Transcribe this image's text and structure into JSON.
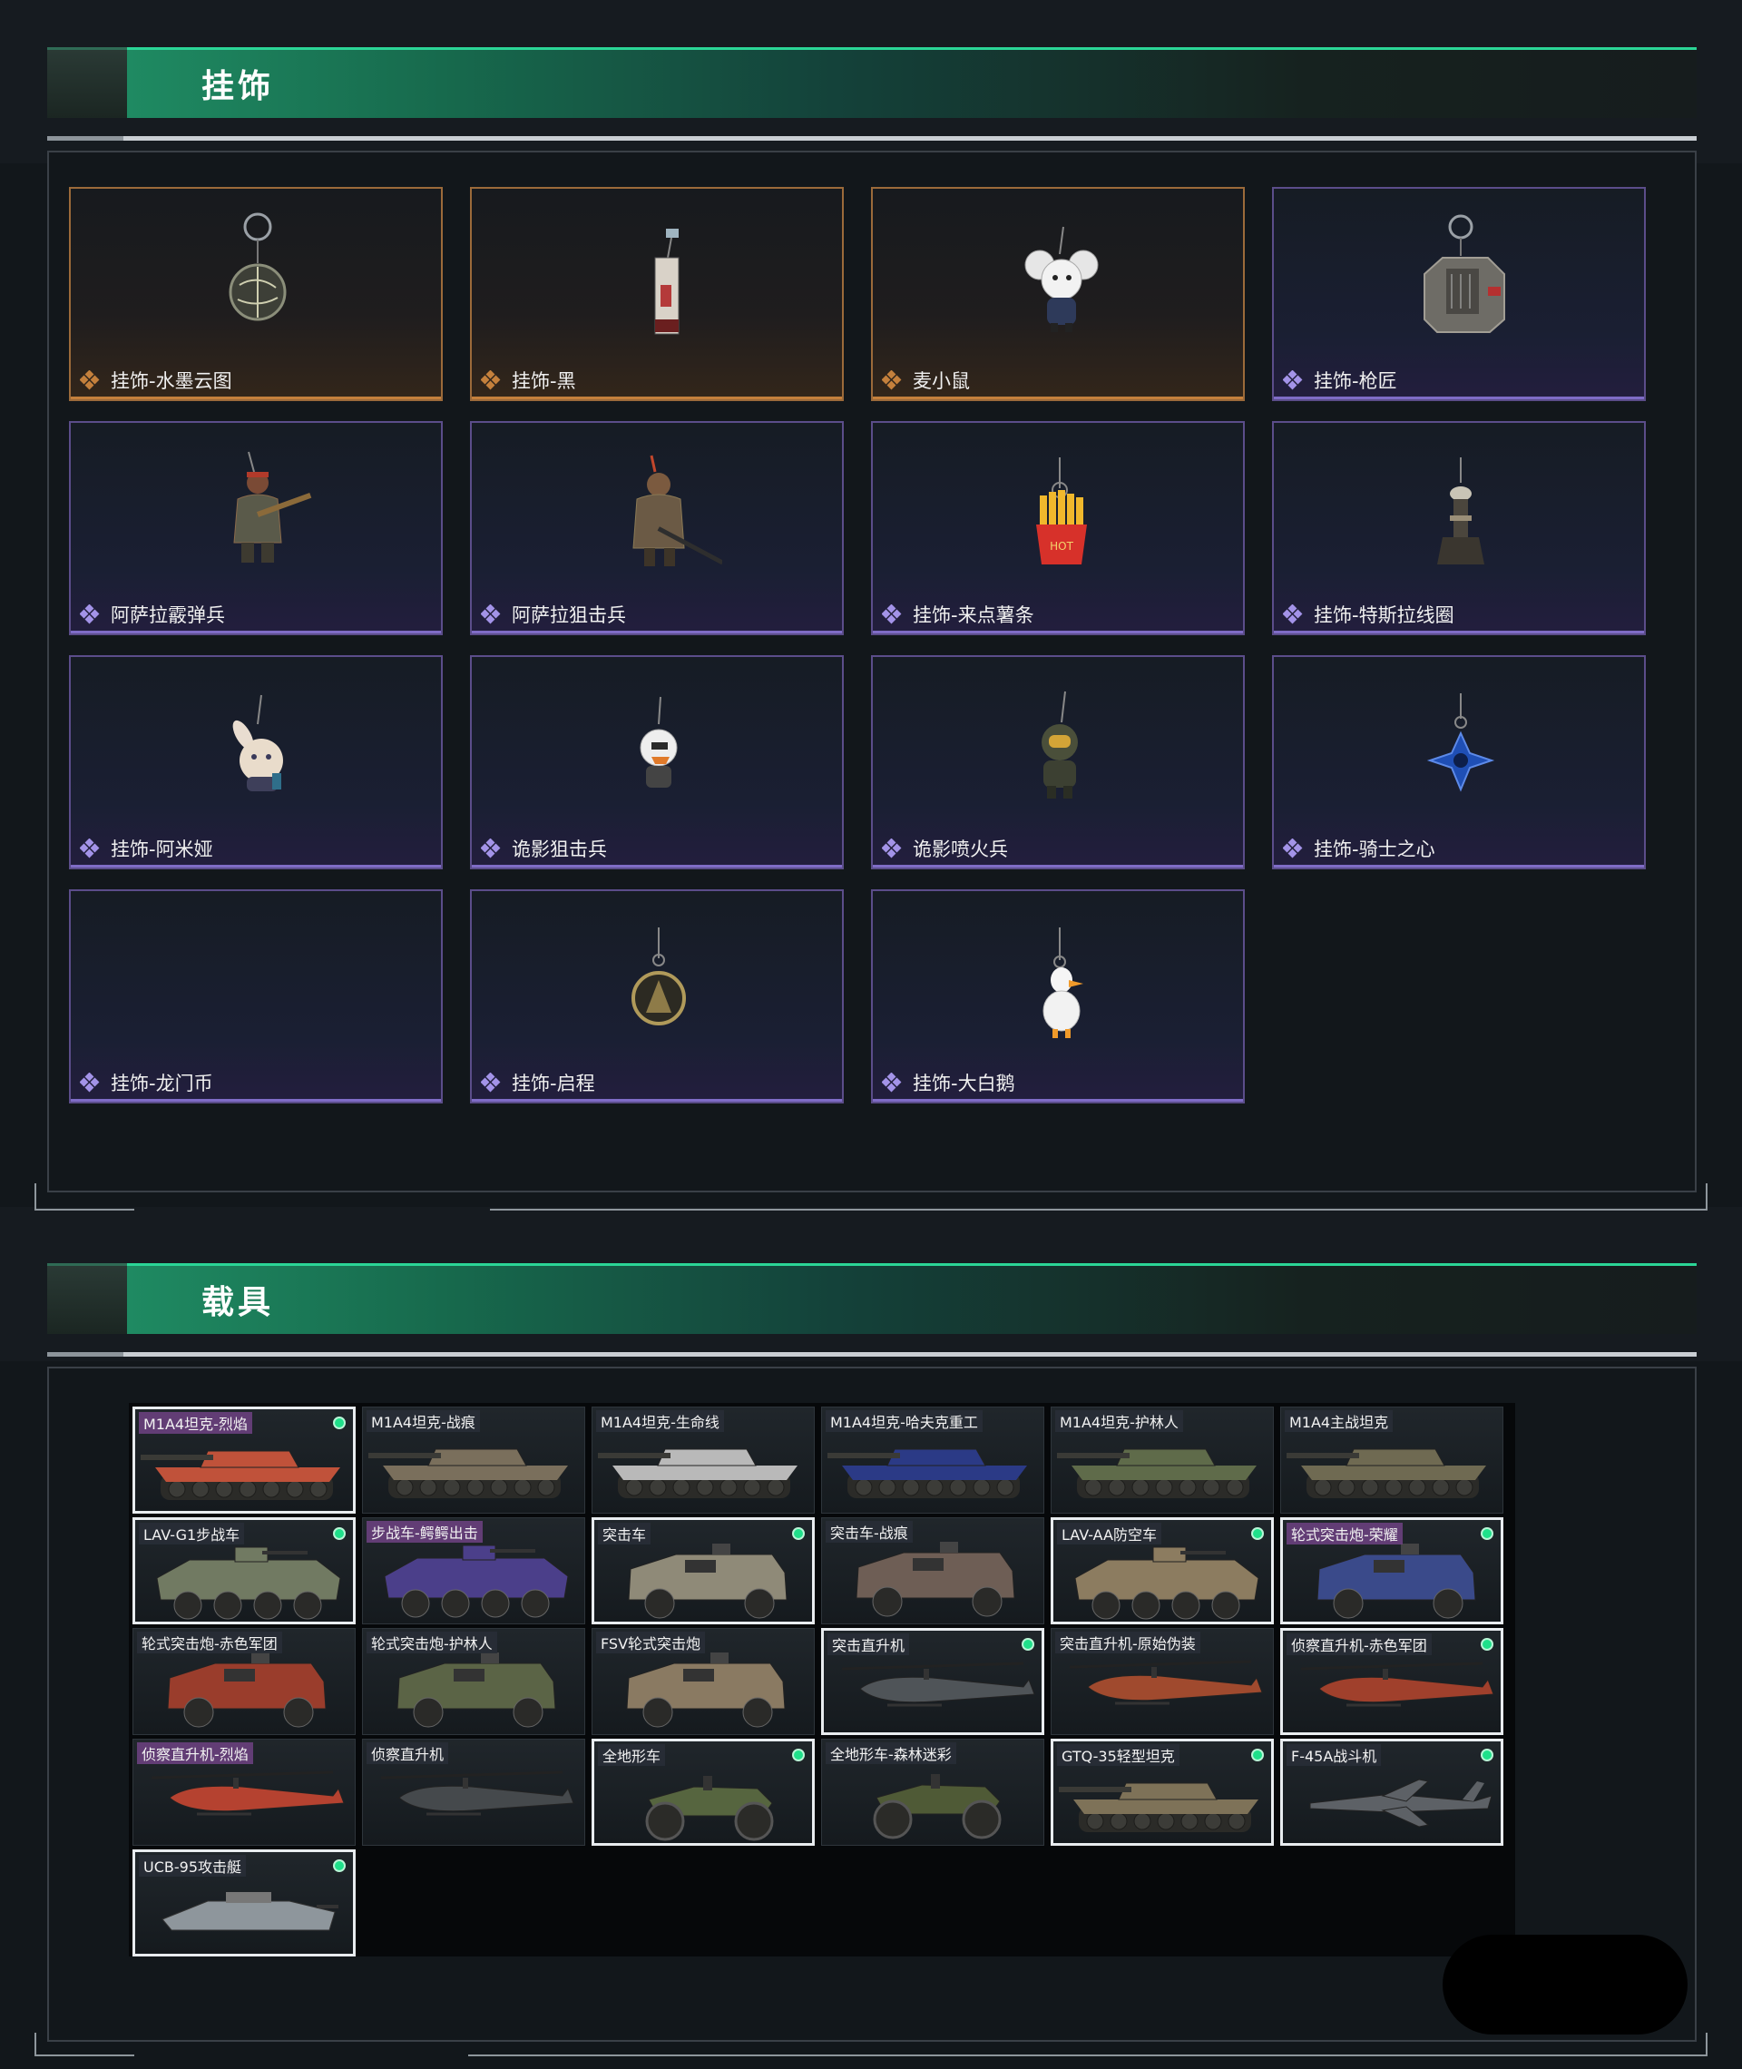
{
  "sections": {
    "charms": {
      "title": "挂饰"
    },
    "vehicles": {
      "title": "载具"
    }
  },
  "charms": [
    {
      "name": "挂饰-水墨云图",
      "rarity": "gold"
    },
    {
      "name": "挂饰-黑",
      "rarity": "gold"
    },
    {
      "name": "麦小鼠",
      "rarity": "gold"
    },
    {
      "name": "挂饰-枪匠",
      "rarity": "purple"
    },
    {
      "name": "阿萨拉霰弹兵",
      "rarity": "purple"
    },
    {
      "name": "阿萨拉狙击兵",
      "rarity": "purple"
    },
    {
      "name": "挂饰-来点薯条",
      "rarity": "purple"
    },
    {
      "name": "挂饰-特斯拉线圈",
      "rarity": "purple"
    },
    {
      "name": "挂饰-阿米娅",
      "rarity": "purple"
    },
    {
      "name": "诡影狙击兵",
      "rarity": "purple"
    },
    {
      "name": "诡影喷火兵",
      "rarity": "purple"
    },
    {
      "name": "挂饰-骑士之心",
      "rarity": "purple"
    },
    {
      "name": "挂饰-龙门币",
      "rarity": "purple"
    },
    {
      "name": "挂饰-启程",
      "rarity": "purple"
    },
    {
      "name": "挂饰-大白鹅",
      "rarity": "purple"
    }
  ],
  "vehicles": [
    {
      "name": "M1A4坦克-烈焰",
      "owned": true,
      "highlight": true,
      "kind": "tank",
      "color": "#c0523a"
    },
    {
      "name": "M1A4坦克-战痕",
      "owned": false,
      "highlight": false,
      "kind": "tank",
      "color": "#7a6f5c"
    },
    {
      "name": "M1A4坦克-生命线",
      "owned": false,
      "highlight": false,
      "kind": "tank",
      "color": "#b9b9b9"
    },
    {
      "name": "M1A4坦克-哈夫克重工",
      "owned": false,
      "highlight": false,
      "kind": "tank",
      "color": "#2b3a86"
    },
    {
      "name": "M1A4坦克-护林人",
      "owned": false,
      "highlight": false,
      "kind": "tank",
      "color": "#5f6b4a"
    },
    {
      "name": "M1A4主战坦克",
      "owned": false,
      "highlight": false,
      "kind": "tank",
      "color": "#6f6a52"
    },
    {
      "name": "LAV-G1步战车",
      "owned": true,
      "highlight": false,
      "kind": "apc",
      "color": "#717a62"
    },
    {
      "name": "步战车-鳄鳄出击",
      "owned": false,
      "highlight": true,
      "kind": "apc",
      "color": "#4b3f8a"
    },
    {
      "name": "突击车",
      "owned": true,
      "highlight": false,
      "kind": "truck",
      "color": "#8f8a78"
    },
    {
      "name": "突击车-战痕",
      "owned": false,
      "highlight": false,
      "kind": "truck",
      "color": "#6e5e55"
    },
    {
      "name": "LAV-AA防空车",
      "owned": true,
      "highlight": false,
      "kind": "apc",
      "color": "#8c7c60"
    },
    {
      "name": "轮式突击炮-荣耀",
      "owned": true,
      "highlight": true,
      "kind": "truck",
      "color": "#3a4a8a"
    },
    {
      "name": "轮式突击炮-赤色军团",
      "owned": false,
      "highlight": false,
      "kind": "truck",
      "color": "#9a3d2c"
    },
    {
      "name": "轮式突击炮-护林人",
      "owned": false,
      "highlight": false,
      "kind": "truck",
      "color": "#5b6446"
    },
    {
      "name": "FSV轮式突击炮",
      "owned": false,
      "highlight": false,
      "kind": "truck",
      "color": "#8a7a62"
    },
    {
      "name": "突击直升机",
      "owned": true,
      "highlight": false,
      "kind": "heli",
      "color": "#4f5458"
    },
    {
      "name": "突击直升机-原始伪装",
      "owned": false,
      "highlight": false,
      "kind": "heli",
      "color": "#a04a2e"
    },
    {
      "name": "侦察直升机-赤色军团",
      "owned": true,
      "highlight": false,
      "kind": "heli",
      "color": "#a0402c"
    },
    {
      "name": "侦察直升机-烈焰",
      "owned": false,
      "highlight": true,
      "kind": "heli",
      "color": "#b54230"
    },
    {
      "name": "侦察直升机",
      "owned": false,
      "highlight": false,
      "kind": "heli",
      "color": "#45494c"
    },
    {
      "name": "全地形车",
      "owned": true,
      "highlight": false,
      "kind": "atv",
      "color": "#56653f"
    },
    {
      "name": "全地形车-森林迷彩",
      "owned": false,
      "highlight": false,
      "kind": "atv",
      "color": "#4f5a36"
    },
    {
      "name": "GTQ-35轻型坦克",
      "owned": true,
      "highlight": false,
      "kind": "tank",
      "color": "#7e7258"
    },
    {
      "name": "F-45A战斗机",
      "owned": true,
      "highlight": false,
      "kind": "jet",
      "color": "#5d6166"
    },
    {
      "name": "UCB-95攻击艇",
      "owned": true,
      "highlight": false,
      "kind": "boat",
      "color": "#8e969c"
    }
  ],
  "colors": {
    "accent_green": "#2bd596",
    "rarity_gold": "#c4803c",
    "rarity_purple": "#7f6cc6",
    "owned_dot": "#1fe08a"
  }
}
